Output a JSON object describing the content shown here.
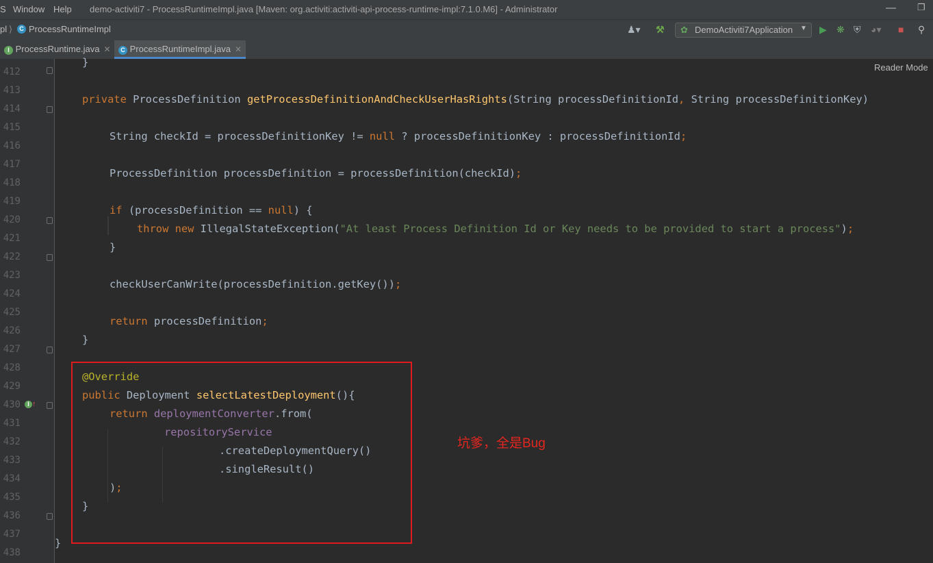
{
  "menu": [
    "S",
    "Window",
    "Help"
  ],
  "window_title": "demo-activiti7 - ProcessRuntimeImpl.java [Maven: org.activiti:activiti-api-process-runtime-impl:7.1.0.M6] - Administrator",
  "breadcrumb": {
    "parent": "pl",
    "current": "ProcessRuntimeImpl"
  },
  "run_config": "DemoActiviti7Application",
  "tabs": [
    {
      "label": "ProcessRuntime.java",
      "active": false
    },
    {
      "label": "ProcessRuntimeImpl.java",
      "active": true
    }
  ],
  "reader_mode": "Reader Mode",
  "line_numbers": [
    "412",
    "413",
    "414",
    "415",
    "416",
    "417",
    "418",
    "419",
    "420",
    "421",
    "422",
    "423",
    "424",
    "425",
    "426",
    "427",
    "428",
    "429",
    "430",
    "431",
    "432",
    "433",
    "434",
    "435",
    "436",
    "437",
    "438"
  ],
  "note": "坑爹，全是Bug",
  "colors": {
    "accent": "#4a88c7",
    "highlight_box": "#e01b1b",
    "note": "#e5261f"
  }
}
